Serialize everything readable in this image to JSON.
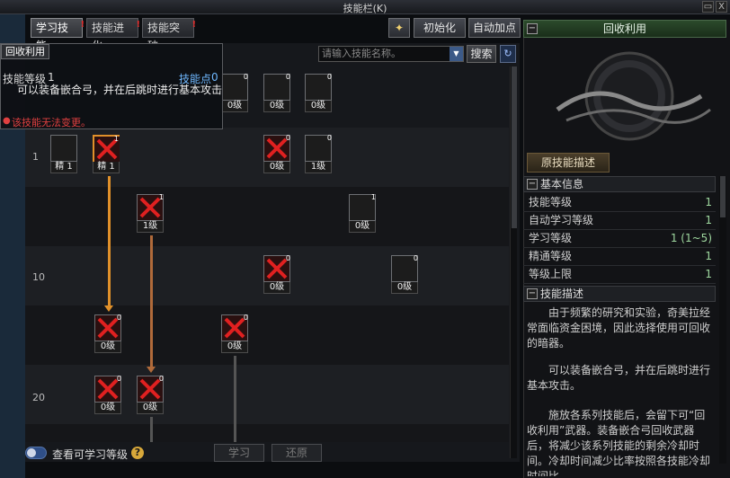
{
  "window": {
    "title": "技能栏(K)",
    "close": "X"
  },
  "tabs": [
    {
      "label": "学习技能",
      "active": true
    },
    {
      "label": "技能进化",
      "active": false
    },
    {
      "label": "技能突破",
      "active": false
    }
  ],
  "tab_alert": "!",
  "toolbar": {
    "reset_label": "初始化",
    "auto_label": "自动加点"
  },
  "search": {
    "placeholder": "请输入技能名称。",
    "button": "搜索"
  },
  "tooltip": {
    "title": "回收利用",
    "level_label": "技能等级",
    "level_value": "1",
    "points_label": "技能点",
    "points_value": "0",
    "text1": "可以装备嵌合弓，并在后跳时进行基本攻击",
    "warning": "该技能无法变更。"
  },
  "level_rows": [
    "1",
    "10",
    "20"
  ],
  "skills": [
    {
      "lbl": "0级",
      "badge": "0",
      "type": "green"
    },
    {
      "lbl": "0级",
      "badge": "0",
      "type": "green"
    },
    {
      "lbl": "0级",
      "badge": "0",
      "type": "blue"
    },
    {
      "lbl": "精 1",
      "badge": "",
      "type": "gold"
    },
    {
      "lbl": "精 1",
      "badge": "1",
      "type": "lock"
    },
    {
      "lbl": "0级",
      "badge": "0",
      "type": "lock"
    },
    {
      "lbl": "1级",
      "badge": "0",
      "type": "gold"
    },
    {
      "lbl": "1级",
      "badge": "1",
      "type": "lock"
    },
    {
      "lbl": "0级",
      "badge": "1",
      "type": "gold"
    },
    {
      "lbl": "0级",
      "badge": "0",
      "type": "lock"
    },
    {
      "lbl": "0级",
      "badge": "0",
      "type": "gold"
    },
    {
      "lbl": "0级",
      "badge": "0",
      "type": "lock"
    },
    {
      "lbl": "0级",
      "badge": "0",
      "type": "lock"
    },
    {
      "lbl": "0级",
      "badge": "0",
      "type": "lock"
    },
    {
      "lbl": "0级",
      "badge": "0",
      "type": "lock"
    }
  ],
  "bottom": {
    "toggle_label": "查看可学习等级",
    "help": "?",
    "learn": "学习",
    "restore": "还原"
  },
  "right_panel": {
    "header": "回收利用",
    "orig_desc_button": "原技能描述",
    "basic_info_title": "基本信息",
    "info": [
      {
        "k": "技能等级",
        "v": "1"
      },
      {
        "k": "自动学习等级",
        "v": "1"
      },
      {
        "k": "学习等级",
        "v": "1 (1~5)"
      },
      {
        "k": "精通等级",
        "v": "1"
      },
      {
        "k": "等级上限",
        "v": "1"
      }
    ],
    "desc_title": "技能描述",
    "desc": [
      "由于频繁的研究和实验，奇美拉经常面临资金困境，因此选择使用可回收的暗器。",
      "可以装备嵌合弓，并在后跳时进行基本攻击。",
      "施放各系列技能后，会留下可“回收利用”武器。装备嵌合弓回收武器后，将减少该系列技能的剩余冷却时间。冷却时间减少比率按照各技能冷却时间比"
    ]
  },
  "colors": {
    "accent_orange": "#e0902a",
    "arrow_brown": "#b06a3a",
    "info_green": "#9fd89f"
  }
}
